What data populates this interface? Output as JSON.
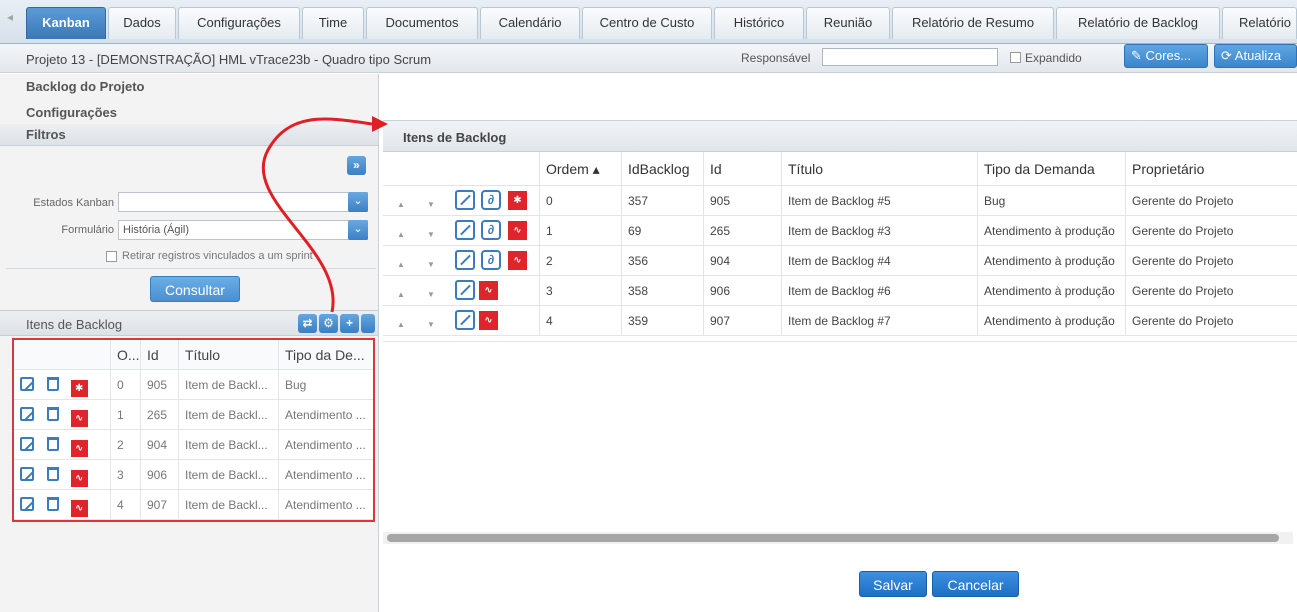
{
  "tabs": [
    {
      "label": "Kanban",
      "active": true
    },
    {
      "label": "Dados"
    },
    {
      "label": "Configurações"
    },
    {
      "label": "Time"
    },
    {
      "label": "Documentos"
    },
    {
      "label": "Calendário"
    },
    {
      "label": "Centro de Custo"
    },
    {
      "label": "Histórico"
    },
    {
      "label": "Reunião"
    },
    {
      "label": "Relatório de Resumo"
    },
    {
      "label": "Relatório de Backlog"
    },
    {
      "label": "Relatório"
    }
  ],
  "project": {
    "title": "Projeto 13 - [DEMONSTRAÇÃO] HML vTrace23b - Quadro tipo Scrum",
    "responsavel_label": "Responsável",
    "responsavel_value": "",
    "expandido_label": "Expandido",
    "cores_label": "Cores...",
    "atualizar_label": "Atualiza"
  },
  "left": {
    "backlog_projeto": "Backlog do Projeto",
    "configuracoes": "Configurações",
    "filtros": "Filtros",
    "estados_label": "Estados Kanban",
    "estados_value": "",
    "formulario_label": "Formulário",
    "formulario_value": "História (Ágil)",
    "retirar_label": "Retirar registros vinculados a um sprint",
    "consultar": "Consultar",
    "itens_title": "Itens de Backlog",
    "columns": [
      "O...",
      "Id",
      "Título",
      "Tipo da De..."
    ],
    "rows": [
      {
        "ordem": "0",
        "id": "905",
        "titulo": "Item de Backl...",
        "tipo": "Bug",
        "icon": "bug"
      },
      {
        "ordem": "1",
        "id": "265",
        "titulo": "Item de Backl...",
        "tipo": "Atendimento ...",
        "icon": "pulse"
      },
      {
        "ordem": "2",
        "id": "904",
        "titulo": "Item de Backl...",
        "tipo": "Atendimento ...",
        "icon": "pulse"
      },
      {
        "ordem": "3",
        "id": "906",
        "titulo": "Item de Backl...",
        "tipo": "Atendimento ...",
        "icon": "pulse"
      },
      {
        "ordem": "4",
        "id": "907",
        "titulo": "Item de Backl...",
        "tipo": "Atendimento ...",
        "icon": "pulse"
      }
    ]
  },
  "right": {
    "title": "Itens de Backlog",
    "columns": [
      "Ordem ▴",
      "IdBacklog",
      "Id",
      "Título",
      "Tipo da Demanda",
      "Proprietário"
    ],
    "rows": [
      {
        "ordem": "0",
        "idbacklog": "357",
        "id": "905",
        "titulo": "Item de Backlog #5",
        "tipo": "Bug",
        "prop": "Gerente do Projeto",
        "link": true,
        "icon": "bug"
      },
      {
        "ordem": "1",
        "idbacklog": "69",
        "id": "265",
        "titulo": "Item de Backlog #3",
        "tipo": "Atendimento à produção",
        "prop": "Gerente do Projeto",
        "link": true,
        "icon": "pulse"
      },
      {
        "ordem": "2",
        "idbacklog": "356",
        "id": "904",
        "titulo": "Item de Backlog #4",
        "tipo": "Atendimento à produção",
        "prop": "Gerente do Projeto",
        "link": true,
        "icon": "pulse"
      },
      {
        "ordem": "3",
        "idbacklog": "358",
        "id": "906",
        "titulo": "Item de Backlog #6",
        "tipo": "Atendimento à produção",
        "prop": "Gerente do Projeto",
        "link": false,
        "icon": "pulse"
      },
      {
        "ordem": "4",
        "idbacklog": "359",
        "id": "907",
        "titulo": "Item de Backlog #7",
        "tipo": "Atendimento à produção",
        "prop": "Gerente do Projeto",
        "link": false,
        "icon": "pulse"
      }
    ],
    "salvar": "Salvar",
    "cancelar": "Cancelar"
  },
  "colors": {
    "accent": "#3a85cc",
    "highlight": "#d9363e",
    "icon_red": "#e0242b"
  }
}
